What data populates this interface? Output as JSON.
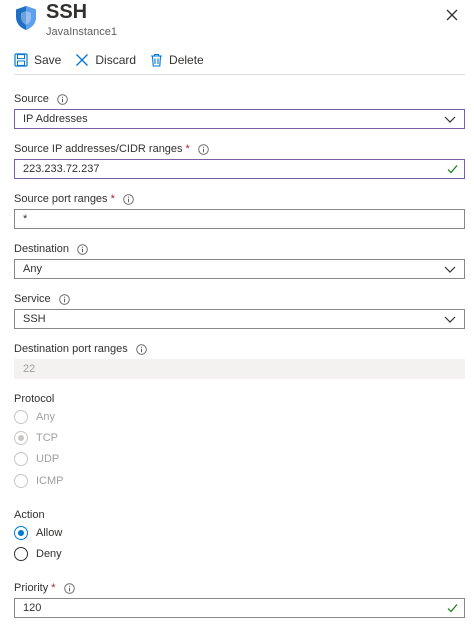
{
  "header": {
    "title": "SSH",
    "subtitle": "JavaInstance1"
  },
  "toolbar": {
    "save_label": "Save",
    "discard_label": "Discard",
    "delete_label": "Delete"
  },
  "fields": {
    "source": {
      "label": "Source",
      "value": "IP Addresses"
    },
    "source_ip": {
      "label": "Source IP addresses/CIDR ranges",
      "required": "*",
      "value": "223.233.72.237"
    },
    "source_port": {
      "label": "Source port ranges",
      "required": "*",
      "value": "*"
    },
    "destination": {
      "label": "Destination",
      "value": "Any"
    },
    "service": {
      "label": "Service",
      "value": "SSH"
    },
    "dest_port": {
      "label": "Destination port ranges",
      "value": "22"
    },
    "priority": {
      "label": "Priority",
      "required": "*",
      "value": "120"
    }
  },
  "protocol": {
    "label": "Protocol",
    "options": [
      "Any",
      "TCP",
      "UDP",
      "ICMP"
    ],
    "selected": "TCP"
  },
  "action": {
    "label": "Action",
    "options": [
      "Allow",
      "Deny"
    ],
    "selected": "Allow"
  },
  "colors": {
    "accent": "#0078d4",
    "active_border": "#7a5fa8",
    "required": "#a4262c",
    "valid_check": "#107c10"
  },
  "icons": {
    "header": "shield-icon",
    "close": "close-icon",
    "save": "save-icon",
    "discard": "discard-icon",
    "delete": "delete-icon",
    "info": "info-icon",
    "dropdown": "chevron-down-icon",
    "valid": "checkmark-icon"
  }
}
